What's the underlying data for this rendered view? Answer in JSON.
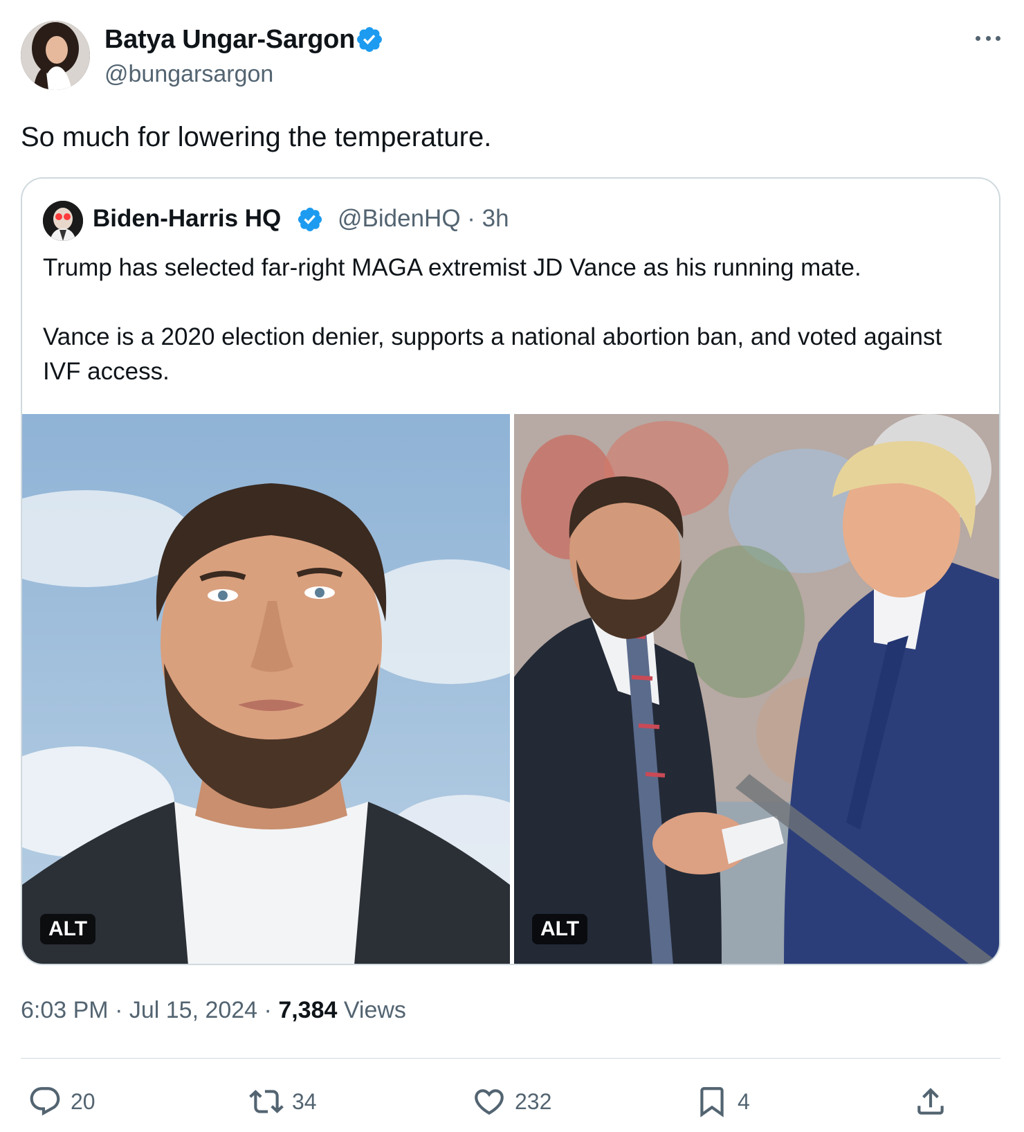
{
  "author": {
    "name": "Batya Ungar-Sargon",
    "handle": "@bungarsargon"
  },
  "tweet": {
    "text": "So much for lowering the temperature."
  },
  "quoted": {
    "name": "Biden-Harris HQ",
    "handle_time": "@BidenHQ · 3h",
    "paragraphs": [
      "Trump has selected far-right MAGA extremist JD Vance as his running mate.",
      "Vance is a 2020 election denier, supports a national abortion ban, and voted against IVF access."
    ],
    "media": [
      {
        "badge": "ALT"
      },
      {
        "badge": "ALT"
      }
    ]
  },
  "meta": {
    "time_date": "6:03 PM · Jul 15, 2024 · ",
    "views_count": "7,384",
    "views_label": " Views"
  },
  "actions": {
    "replies": "20",
    "reposts": "34",
    "likes": "232",
    "bookmarks": "4"
  },
  "colors": {
    "verified": "#1d9bf0",
    "secondary_text": "#536471",
    "border": "#cfd9de"
  },
  "icons": [
    "verified-badge-icon",
    "more-icon",
    "reply-icon",
    "repost-icon",
    "like-icon",
    "bookmark-icon",
    "share-icon"
  ]
}
